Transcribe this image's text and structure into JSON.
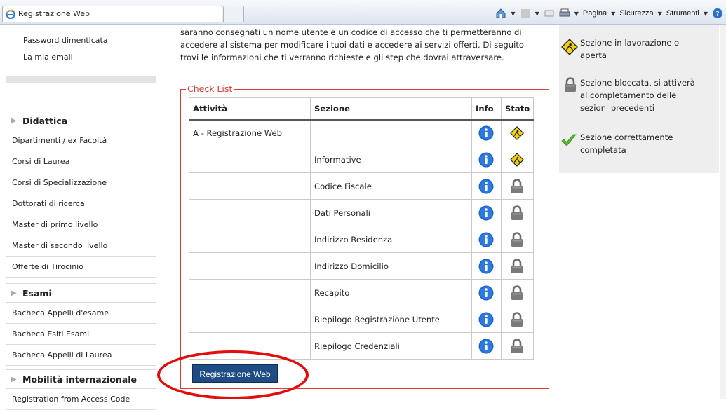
{
  "browser": {
    "tab_title": "Registrazione Web",
    "menus": [
      "Pagina",
      "Sicurezza",
      "Strumenti"
    ]
  },
  "sidebar": {
    "links_top": [
      "Password dimenticata",
      "La mia email"
    ],
    "sections": [
      {
        "title": "Didattica",
        "items": [
          "Dipartimenti / ex Facoltà",
          "Corsi di Laurea",
          "Corsi di Specializzazione",
          "Dottorati di ricerca",
          "Master di primo livello",
          "Master di secondo livello",
          "Offerte di Tirocinio"
        ]
      },
      {
        "title": "Esami",
        "items": [
          "Bacheca Appelli d'esame",
          "Bacheca Esiti Esami",
          "Bacheca Appelli di Laurea"
        ]
      },
      {
        "title": "Mobilità internazionale",
        "items": [
          "Registration from Access Code"
        ]
      }
    ]
  },
  "intro": {
    "line1": "saranno consegnati un nome utente e un codice di accesso che ti permetteranno di",
    "line2": "accedere al sistema per modificare i tuoi dati e accedere ai servizi offerti. Di seguito",
    "line3": "trovi le informazioni che ti verranno richieste e gli step che dovrai attraversare."
  },
  "checklist": {
    "legend": "Check List",
    "headers": {
      "attivita": "Attività",
      "sezione": "Sezione",
      "info": "Info",
      "stato": "Stato"
    },
    "rows": [
      {
        "attivita": "A - Registrazione Web",
        "sezione": "",
        "stato": "open"
      },
      {
        "attivita": "",
        "sezione": "Informative",
        "stato": "open"
      },
      {
        "attivita": "",
        "sezione": "Codice Fiscale",
        "stato": "locked"
      },
      {
        "attivita": "",
        "sezione": "Dati Personali",
        "stato": "locked"
      },
      {
        "attivita": "",
        "sezione": "Indirizzo Residenza",
        "stato": "locked"
      },
      {
        "attivita": "",
        "sezione": "Indirizzo Domicilio",
        "stato": "locked"
      },
      {
        "attivita": "",
        "sezione": "Recapito",
        "stato": "locked"
      },
      {
        "attivita": "",
        "sezione": "Riepilogo Registrazione Utente",
        "stato": "locked"
      },
      {
        "attivita": "",
        "sezione": "Riepilogo Credenziali",
        "stato": "locked"
      }
    ],
    "button": "Registrazione Web"
  },
  "legend_panel": {
    "open": [
      "Sezione in lavorazione o",
      "aperta"
    ],
    "locked": [
      "Sezione bloccata, si attiverà",
      "al completamento delle",
      "sezioni precedenti"
    ],
    "done": [
      "Sezione correttamente",
      "completata"
    ]
  },
  "colors": {
    "accent_red": "#e23a32",
    "button_blue": "#1d4d82",
    "highlight": "#e30d0d"
  }
}
